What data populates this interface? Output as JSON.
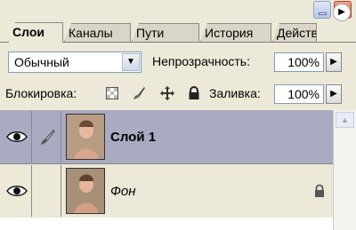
{
  "tabs": [
    {
      "label": "Слои"
    },
    {
      "label": "Каналы"
    },
    {
      "label": "Пути"
    },
    {
      "label": "История"
    },
    {
      "label": "Действия"
    }
  ],
  "blend": {
    "mode": "Обычный"
  },
  "opacity": {
    "label": "Непрозрачность:",
    "value": "100%"
  },
  "lock": {
    "label": "Блокировка:"
  },
  "fill": {
    "label": "Заливка:",
    "value": "100%"
  },
  "layers": [
    {
      "name": "Слой 1",
      "selected": true
    },
    {
      "name": "Фон",
      "locked": true
    }
  ],
  "colors": {
    "selected_row": "#a9abc2",
    "panel_bg": "#ece9d8"
  }
}
